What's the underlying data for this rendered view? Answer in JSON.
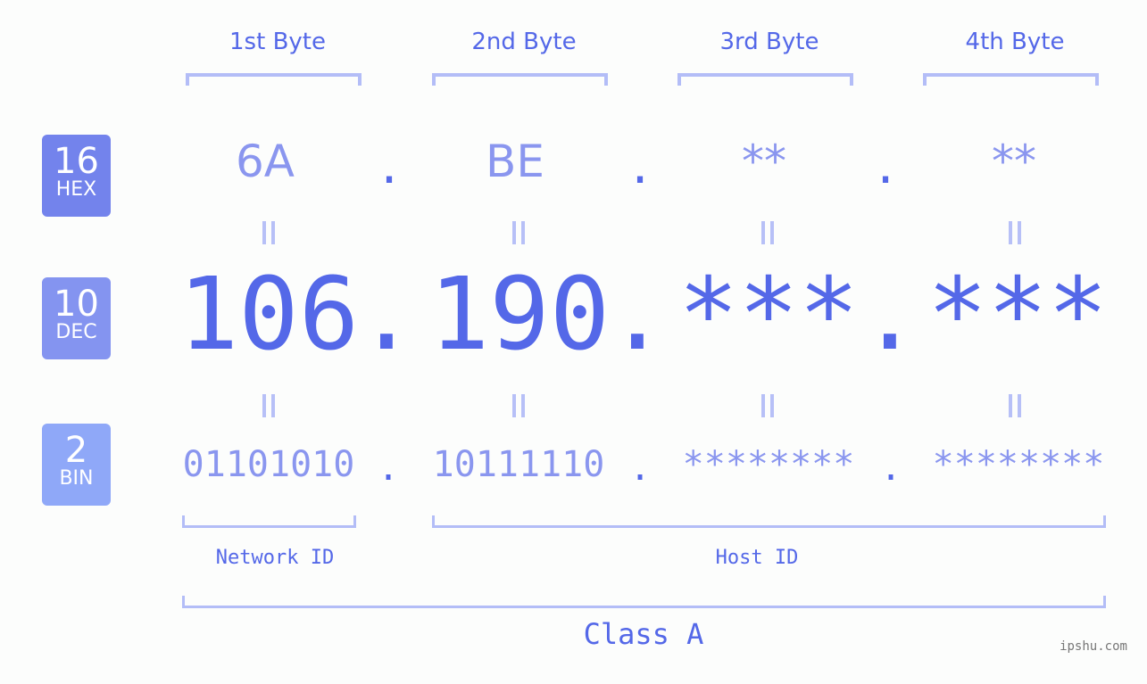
{
  "byte_headers": [
    "1st Byte",
    "2nd Byte",
    "3rd Byte",
    "4th Byte"
  ],
  "badges": {
    "hex": {
      "number": "16",
      "label": "HEX",
      "color": "#7383ec"
    },
    "dec": {
      "number": "10",
      "label": "DEC",
      "color": "#8494f0"
    },
    "bin": {
      "number": "2",
      "label": "BIN",
      "color": "#8fa8f8"
    }
  },
  "hex": [
    "6A",
    "BE",
    "**",
    "**"
  ],
  "dec": [
    "106",
    "190",
    "***",
    "***"
  ],
  "bin": [
    "01101010",
    "10111110",
    "********",
    "********"
  ],
  "separator": ".",
  "network_id_label": "Network ID",
  "host_id_label": "Host ID",
  "class_label": "Class A",
  "watermark": "ipshu.com",
  "colors": {
    "accent": "#5468e8",
    "light_accent": "#8a96ef",
    "bracket": "#b3bdf7"
  }
}
